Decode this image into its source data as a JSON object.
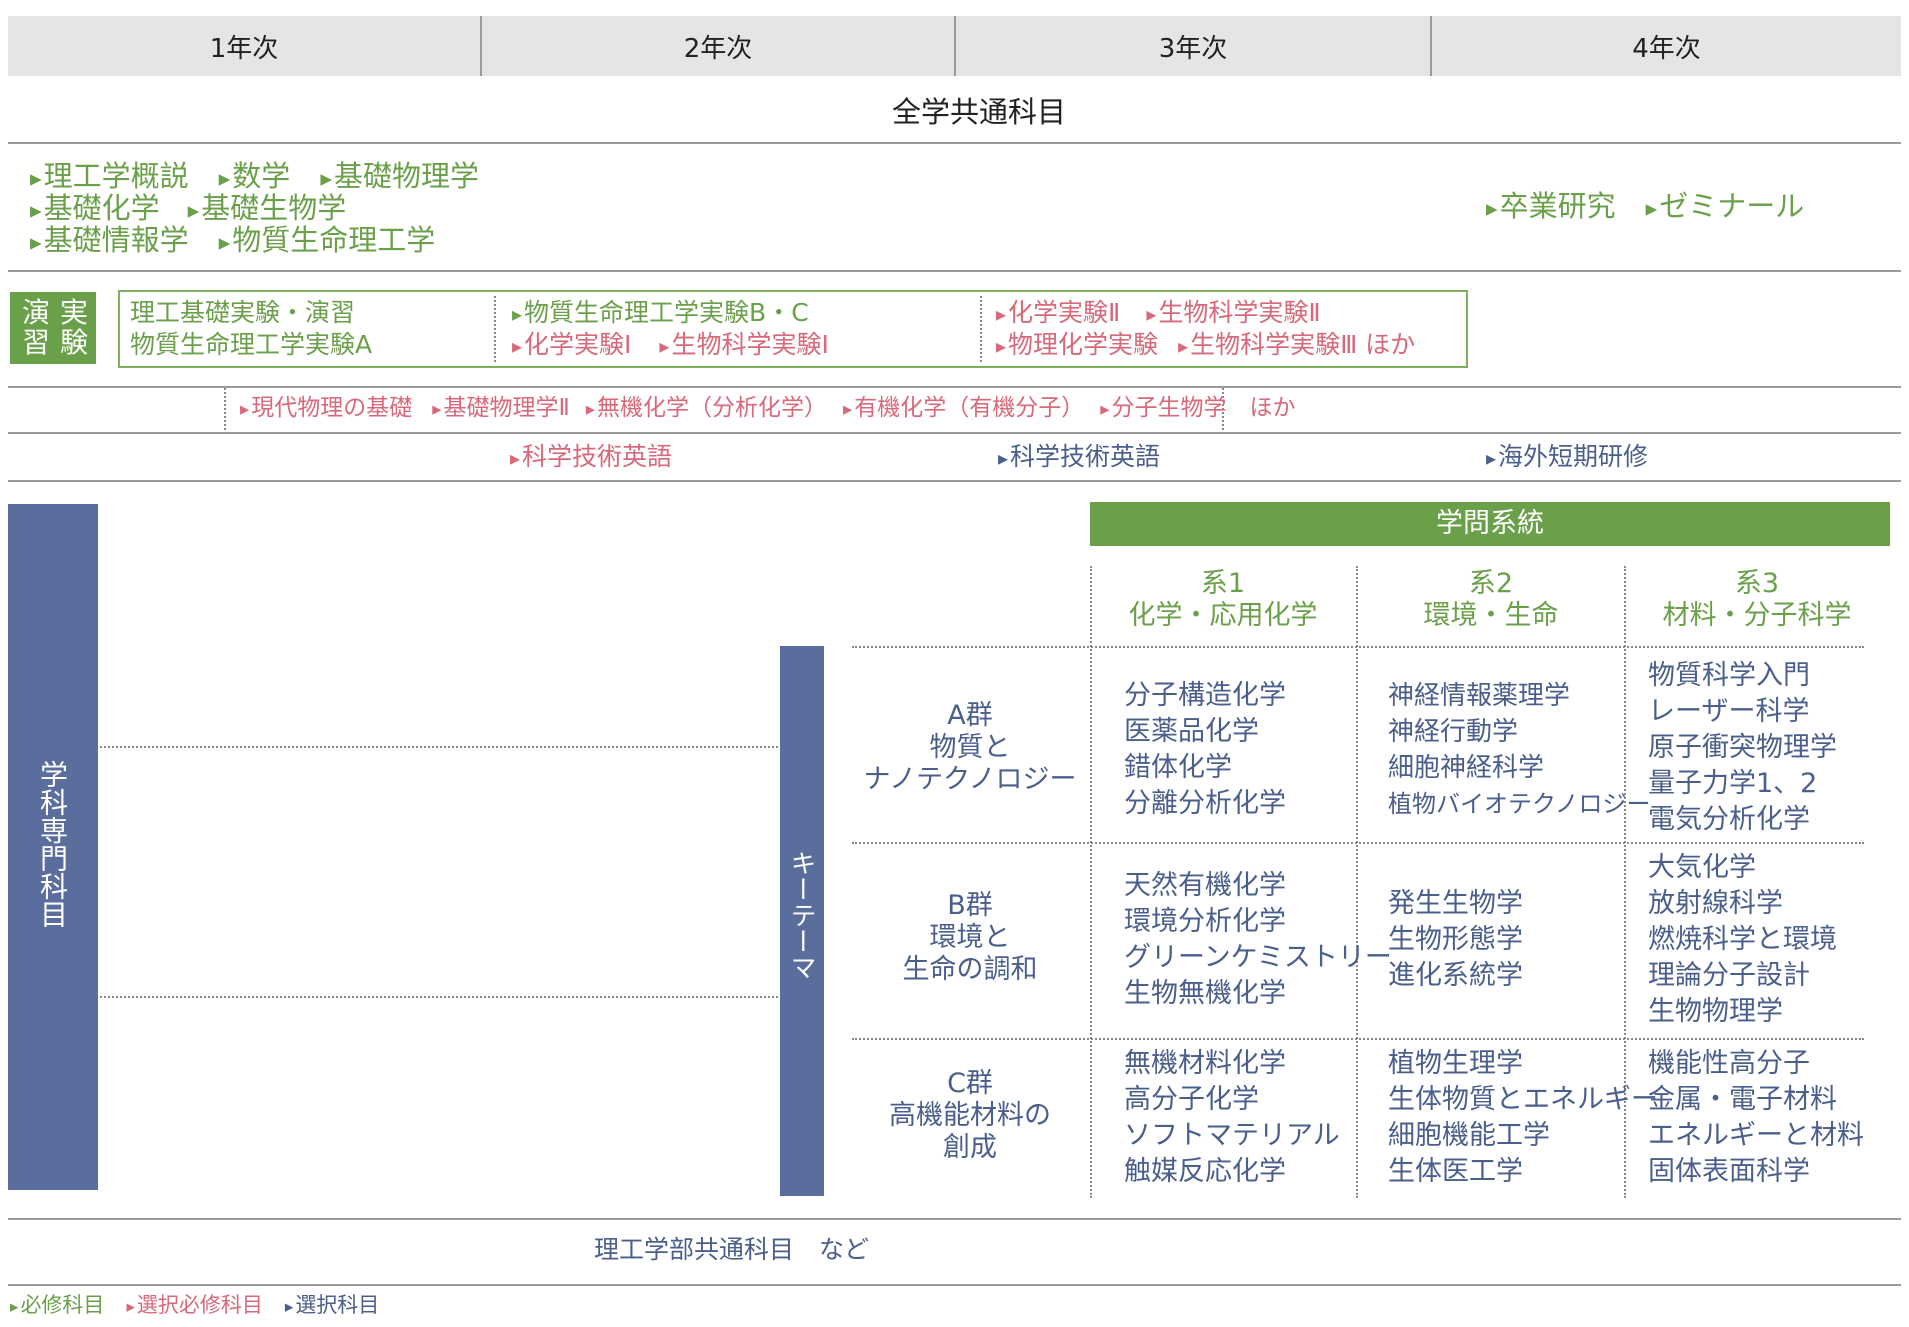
{
  "years": [
    "1年次",
    "2年次",
    "3年次",
    "4年次"
  ],
  "common": {
    "title": "全学共通科目",
    "left_rows": [
      [
        "理工学概説",
        "数学",
        "基礎物理学"
      ],
      [
        "基礎化学",
        "基礎生物学"
      ],
      [
        "基礎情報学",
        "物質生命理工学"
      ]
    ],
    "right": [
      "卒業研究",
      "ゼミナール"
    ]
  },
  "practice": {
    "label": [
      "演",
      "実",
      "習",
      "験"
    ],
    "col1": [
      "理工基礎実験・演習",
      "物質生命理工学実験A"
    ],
    "col2_row1": "物質生命理工学実験B・C",
    "col2_row2": [
      "化学実験Ⅰ",
      "生物科学実験Ⅰ"
    ],
    "col3_row1": [
      "化学実験Ⅱ",
      "生物科学実験Ⅱ"
    ],
    "col3_row2": [
      "物理化学実験",
      "生物科学実験Ⅲ ほか"
    ]
  },
  "electives_row": [
    "現代物理の基礎",
    "基礎物理学Ⅱ",
    "無機化学（分析化学）",
    "有機化学（有機分子）",
    "分子生物学　ほか"
  ],
  "english_row": [
    "科学技術英語",
    "科学技術英語",
    "海外短期研修"
  ],
  "specialty": {
    "label": "学科専門科目",
    "key_theme": "キーテーマ",
    "header": "学問系統",
    "systems": [
      {
        "num": "系1",
        "name": "化学・応用化学"
      },
      {
        "num": "系2",
        "name": "環境・生命"
      },
      {
        "num": "系3",
        "name": "材料・分子科学"
      }
    ],
    "groups": [
      {
        "name": [
          "A群",
          "物質と",
          "ナノテクノロジー"
        ],
        "cells": [
          [
            "分子構造化学",
            "医薬品化学",
            "錯体化学",
            "分離分析化学"
          ],
          [
            "神経情報薬理学",
            "神経行動学",
            "細胞神経科学",
            "植物バイオテクノロジー"
          ],
          [
            "物質科学入門",
            "レーザー科学",
            "原子衝突物理学",
            "量子力学1、2",
            "電気分析化学"
          ]
        ]
      },
      {
        "name": [
          "B群",
          "環境と",
          "生命の調和"
        ],
        "cells": [
          [
            "天然有機化学",
            "環境分析化学",
            "グリーンケミストリー",
            "生物無機化学"
          ],
          [
            "発生生物学",
            "生物形態学",
            "進化系統学"
          ],
          [
            "大気化学",
            "放射線科学",
            "燃焼科学と環境",
            "理論分子設計",
            "生物物理学"
          ]
        ]
      },
      {
        "name": [
          "C群",
          "高機能材料の",
          "創成"
        ],
        "cells": [
          [
            "無機材料化学",
            "高分子化学",
            "ソフトマテリアル",
            "触媒反応化学"
          ],
          [
            "植物生理学",
            "生体物質とエネルギー",
            "細胞機能工学",
            "生体医工学"
          ],
          [
            "機能性高分子",
            "金属・電子材料",
            "エネルギーと材料",
            "固体表面科学"
          ]
        ]
      }
    ]
  },
  "bottom": "理工学部共通科目　など",
  "legend": [
    "必修科目",
    "選択必修科目",
    "選択科目"
  ],
  "colors": {
    "required": "#6ba04a",
    "elective_required": "#d8697a",
    "elective": "#4b5f8c",
    "panel": "#5a6d9c",
    "header_bg": "#e5e5e5"
  }
}
